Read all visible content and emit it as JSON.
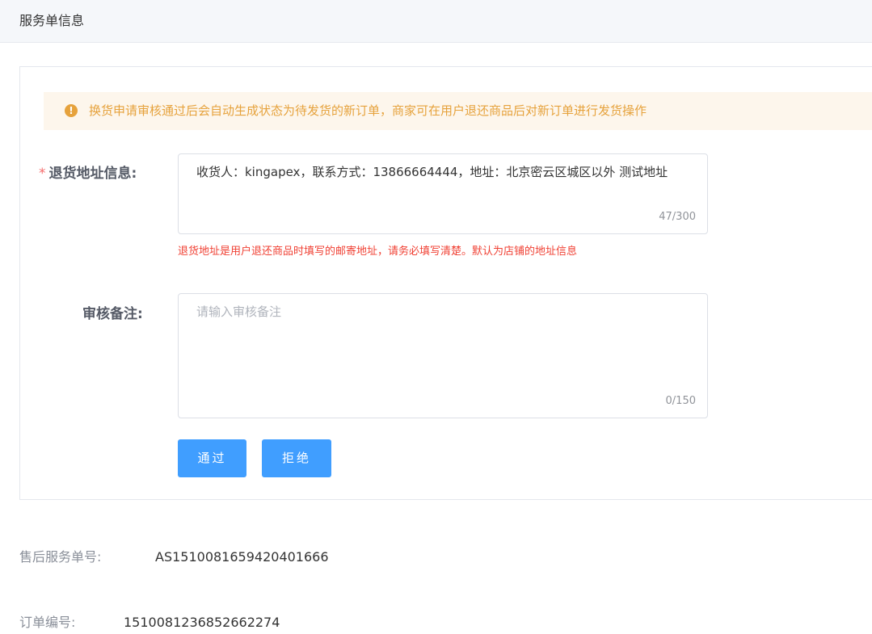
{
  "section": {
    "title": "服务单信息"
  },
  "notice": {
    "icon": "exclamation-circle-icon",
    "icon_glyph": "!",
    "text": "换货申请审核通过后会自动生成状态为待发货的新订单，商家可在用户退还商品后对新订单进行发货操作",
    "color": "#e6a23c"
  },
  "form": {
    "return_address": {
      "required_mark": "*",
      "label": "退货地址信息:",
      "value": "收货人：kingapex，联系方式：13866664444，地址：北京密云区城区以外 测试地址",
      "count": "47/300",
      "hint": "退货地址是用户退还商品时填写的邮寄地址，请务必填写清楚。默认为店铺的地址信息"
    },
    "review_note": {
      "label": "审核备注:",
      "value": "",
      "placeholder": "请输入审核备注",
      "count": "0/150"
    },
    "buttons": {
      "approve_label": "通过",
      "reject_label": "拒绝"
    }
  },
  "info": {
    "service_no_label": "售后服务单号:",
    "service_no_value": "AS1510081659420401666",
    "order_no_label": "订单编号:",
    "order_no_value": "1510081236852662274"
  },
  "colors": {
    "primary": "#409eff",
    "error": "#f04134",
    "warning_bg": "#fdf6ec"
  }
}
